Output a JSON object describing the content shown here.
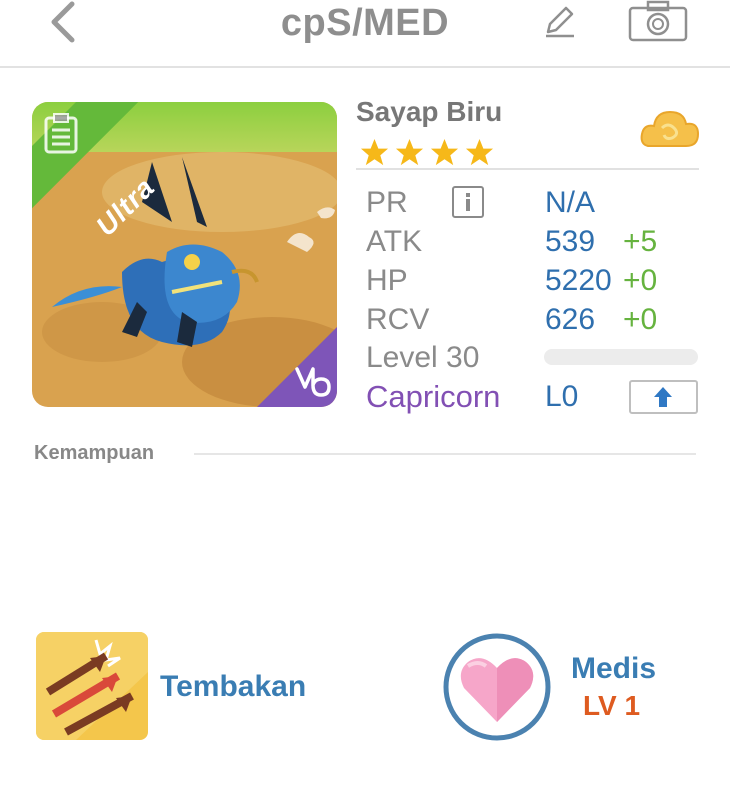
{
  "header": {
    "title": "cpS/MED",
    "back_icon": "chevron-left-icon",
    "edit_icon": "pencil-icon",
    "camera_icon": "camera-icon"
  },
  "monster": {
    "name": "Sayap Biru",
    "rarity_label": "Ultra",
    "stars": 4,
    "element_icon": "cloud-icon",
    "zodiac_icon": "capricorn-icon"
  },
  "stats": {
    "pr_label": "PR",
    "pr_value": "N/A",
    "atk_label": "ATK",
    "atk_value": "539",
    "atk_bonus": "+5",
    "hp_label": "HP",
    "hp_value": "5220",
    "hp_bonus": "+0",
    "rcv_label": "RCV",
    "rcv_value": "626",
    "rcv_bonus": "+0",
    "level_label": "Level 30",
    "level_progress": 0.0,
    "zodiac_label": "Capricorn",
    "zodiac_level": "L0"
  },
  "abilities": {
    "section_title": "Kemampuan",
    "skill1_name": "Tembakan",
    "skill2_name": "Medis",
    "skill2_level": "LV 1"
  },
  "colors": {
    "accent_blue": "#2f6fae",
    "bonus_green": "#66b33f",
    "ultra_green": "#64b93a",
    "zodiac_purple": "#8250b4",
    "level_orange": "#de5b20"
  }
}
